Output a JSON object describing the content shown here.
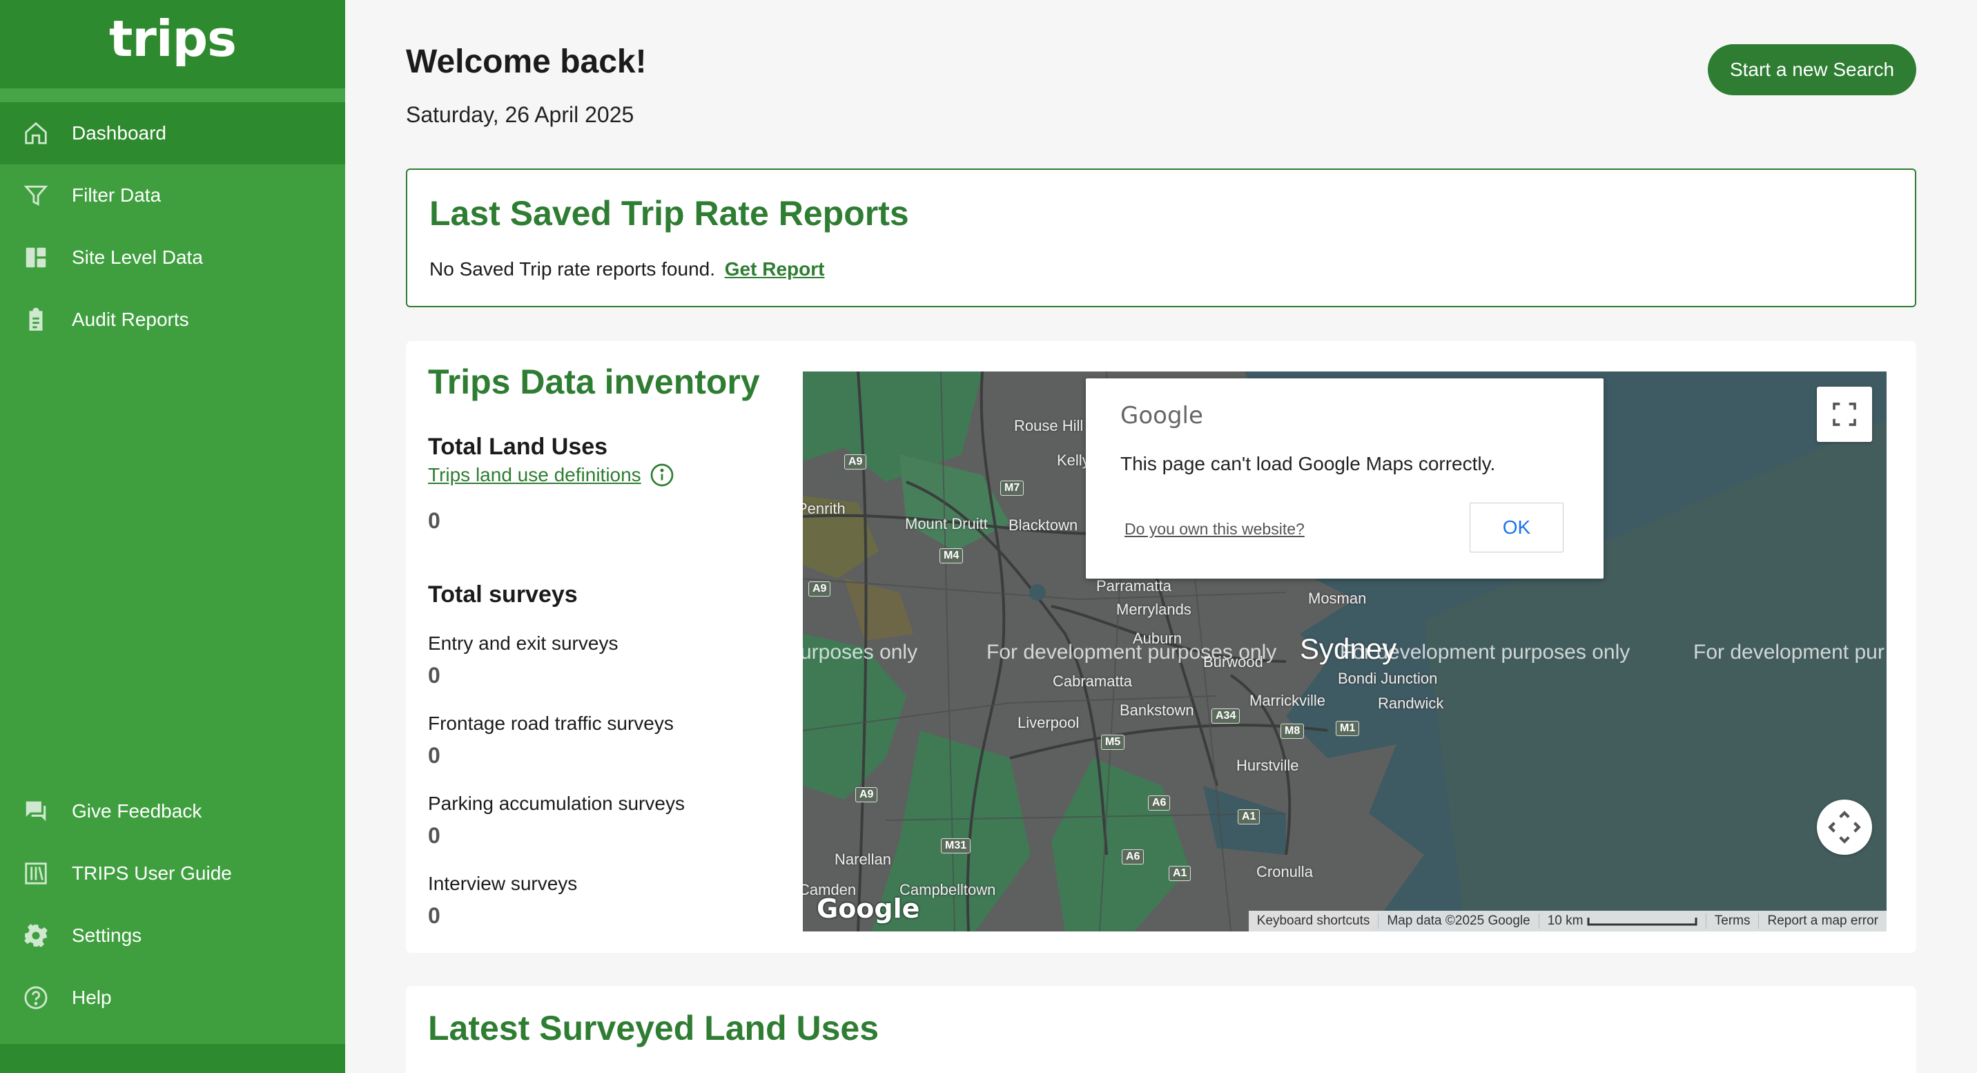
{
  "app": {
    "brand": "trips"
  },
  "sidebar": {
    "items": [
      {
        "label": "Dashboard",
        "icon": "home-icon",
        "active": true
      },
      {
        "label": "Filter Data",
        "icon": "filter-icon"
      },
      {
        "label": "Site Level Data",
        "icon": "dashboard-grid-icon"
      },
      {
        "label": "Audit Reports",
        "icon": "clipboard-icon"
      }
    ],
    "bottom_items": [
      {
        "label": "Give Feedback",
        "icon": "feedback-icon"
      },
      {
        "label": "TRIPS User Guide",
        "icon": "book-icon"
      },
      {
        "label": "Settings",
        "icon": "gear-icon"
      },
      {
        "label": "Help",
        "icon": "help-icon"
      }
    ]
  },
  "header": {
    "welcome": "Welcome back!",
    "date": "Saturday, 26 April 2025",
    "new_search_label": "Start a new Search"
  },
  "saved_reports": {
    "title": "Last Saved Trip Rate Reports",
    "message": "No Saved Trip rate reports found.",
    "link_label": "Get Report"
  },
  "inventory": {
    "title": "Trips Data inventory",
    "land_uses_heading": "Total Land Uses",
    "definitions_link": "Trips land use definitions",
    "land_uses_count": "0",
    "surveys_heading": "Total surveys",
    "surveys": [
      {
        "label": "Entry and exit surveys",
        "count": "0"
      },
      {
        "label": "Frontage road traffic surveys",
        "count": "0"
      },
      {
        "label": "Parking accumulation surveys",
        "count": "0"
      },
      {
        "label": "Interview surveys",
        "count": "0"
      }
    ]
  },
  "map": {
    "dev_text": "For development purposes only",
    "dev_text_left": "urposes only",
    "dev_text_right": "For development pur",
    "city_label": "Sydney",
    "places": [
      "Rouse Hill",
      "Kellyville",
      "Penrith",
      "Mount Druitt",
      "Blacktown",
      "Parramatta",
      "Merrylands",
      "Auburn",
      "Burwood",
      "Mosman",
      "Bondi Junction",
      "Randwick",
      "Cabramatta",
      "Marrickville",
      "Liverpool",
      "Bankstown",
      "Hurstville",
      "Narellan",
      "Camden",
      "Campbelltown",
      "Cronulla"
    ],
    "shields": [
      "A9",
      "M7",
      "M4",
      "A9",
      "M5",
      "A34",
      "M8",
      "M1",
      "A9",
      "A6",
      "A1",
      "M31",
      "A6",
      "A1"
    ],
    "google_logo": "Google",
    "attribution": [
      "Keyboard shortcuts",
      "Map data ©2025 Google",
      "10 km",
      "Terms",
      "Report a map error"
    ],
    "dialog": {
      "logo": "Google",
      "message": "This page can't load Google Maps correctly.",
      "own_link": "Do you own this website?",
      "ok_label": "OK"
    }
  },
  "latest": {
    "title": "Latest Surveyed Land Uses"
  },
  "colors": {
    "sidebar": "#3f9f3f",
    "sidebar_dark": "#2e8a2e",
    "accent": "#2e7d32"
  }
}
